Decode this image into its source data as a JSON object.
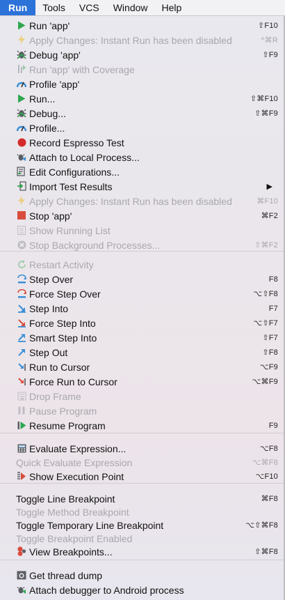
{
  "menubar": [
    "Run",
    "Tools",
    "VCS",
    "Window",
    "Help"
  ],
  "items": [
    {
      "label": "Run 'app'",
      "shortcut": "⇧F10",
      "icon": "play-green",
      "enabled": true
    },
    {
      "label": "Apply Changes: Instant Run has been disabled",
      "shortcut": "^⌘R",
      "icon": "bolt",
      "enabled": false
    },
    {
      "label": "Debug 'app'",
      "shortcut": "⇧F9",
      "icon": "bug",
      "enabled": true
    },
    {
      "label": "Run 'app' with Coverage",
      "shortcut": "",
      "icon": "coverage",
      "enabled": false
    },
    {
      "label": "Profile 'app'",
      "shortcut": "",
      "icon": "gauge",
      "enabled": true
    },
    {
      "label": "Run...",
      "shortcut": "⇧⌘F10",
      "icon": "play-green",
      "enabled": true
    },
    {
      "label": "Debug...",
      "shortcut": "⇧⌘F9",
      "icon": "bug",
      "enabled": true
    },
    {
      "label": "Profile...",
      "shortcut": "",
      "icon": "gauge",
      "enabled": true
    },
    {
      "label": "Record Espresso Test",
      "shortcut": "",
      "icon": "record-red",
      "enabled": true
    },
    {
      "label": "Attach to Local Process...",
      "shortcut": "",
      "icon": "attach",
      "enabled": true
    },
    {
      "label": "Edit Configurations...",
      "shortcut": "",
      "icon": "edit-config",
      "enabled": true
    },
    {
      "label": "Import Test Results",
      "shortcut": "",
      "icon": "import",
      "enabled": true,
      "submenu": true
    },
    {
      "label": "Apply Changes: Instant Run has been disabled",
      "shortcut": "⌘F10",
      "icon": "bolt",
      "enabled": false
    },
    {
      "label": "Stop 'app'",
      "shortcut": "⌘F2",
      "icon": "stop-red",
      "enabled": true
    },
    {
      "label": "Show Running List",
      "shortcut": "",
      "icon": "list",
      "enabled": false
    },
    {
      "label": "Stop Background Processes...",
      "shortcut": "⇧⌘F2",
      "icon": "stop-circle",
      "enabled": false
    },
    {
      "label": "Restart Activity",
      "shortcut": "",
      "icon": "restart",
      "enabled": false
    },
    {
      "label": "Step Over",
      "shortcut": "F8",
      "icon": "step-over",
      "enabled": true
    },
    {
      "label": "Force Step Over",
      "shortcut": "⌥⇧F8",
      "icon": "force-step-over",
      "enabled": true
    },
    {
      "label": "Step Into",
      "shortcut": "F7",
      "icon": "step-into",
      "enabled": true
    },
    {
      "label": "Force Step Into",
      "shortcut": "⌥⇧F7",
      "icon": "force-step-into",
      "enabled": true
    },
    {
      "label": "Smart Step Into",
      "shortcut": "⇧F7",
      "icon": "smart-step-into",
      "enabled": true
    },
    {
      "label": "Step Out",
      "shortcut": "⇧F8",
      "icon": "step-out",
      "enabled": true
    },
    {
      "label": "Run to Cursor",
      "shortcut": "⌥F9",
      "icon": "run-to-cursor",
      "enabled": true
    },
    {
      "label": "Force Run to Cursor",
      "shortcut": "⌥⌘F9",
      "icon": "force-run-to-cursor",
      "enabled": true
    },
    {
      "label": "Drop Frame",
      "shortcut": "",
      "icon": "drop-frame",
      "enabled": false
    },
    {
      "label": "Pause Program",
      "shortcut": "",
      "icon": "pause",
      "enabled": false
    },
    {
      "label": "Resume Program",
      "shortcut": "F9",
      "icon": "resume",
      "enabled": true
    },
    {
      "label": "Evaluate Expression...",
      "shortcut": "⌥F8",
      "icon": "calculator",
      "enabled": true
    },
    {
      "label": "Quick Evaluate Expression",
      "shortcut": "⌥⌘F8",
      "icon": "",
      "enabled": false
    },
    {
      "label": "Show Execution Point",
      "shortcut": "⌥F10",
      "icon": "exec-point",
      "enabled": true
    },
    {
      "label": "Toggle Line Breakpoint",
      "shortcut": "⌘F8",
      "icon": "",
      "enabled": true
    },
    {
      "label": "Toggle Method Breakpoint",
      "shortcut": "",
      "icon": "",
      "enabled": false
    },
    {
      "label": "Toggle Temporary Line Breakpoint",
      "shortcut": "⌥⇧⌘F8",
      "icon": "",
      "enabled": true
    },
    {
      "label": "Toggle Breakpoint Enabled",
      "shortcut": "",
      "icon": "",
      "enabled": false
    },
    {
      "label": "View Breakpoints...",
      "shortcut": "⇧⌘F8",
      "icon": "breakpoints",
      "enabled": true
    },
    {
      "label": "Get thread dump",
      "shortcut": "",
      "icon": "camera",
      "enabled": true
    },
    {
      "label": "Attach debugger to Android process",
      "shortcut": "",
      "icon": "attach-android",
      "enabled": true
    }
  ],
  "submenu_arrow": "▶"
}
